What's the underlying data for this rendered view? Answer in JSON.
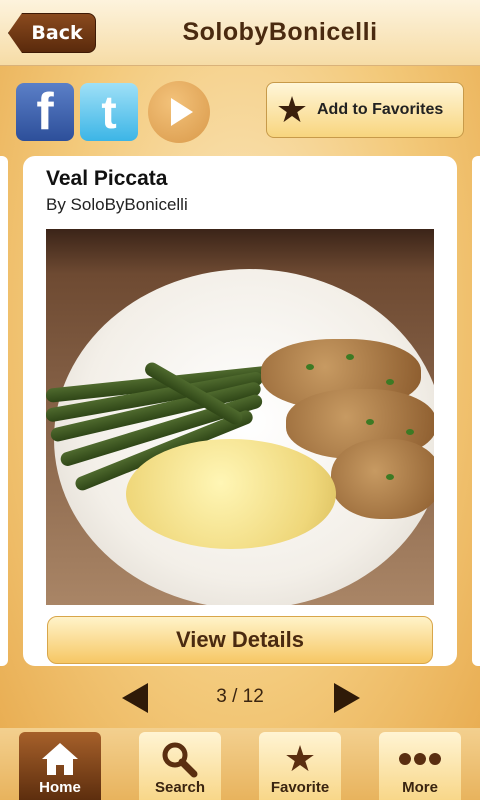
{
  "header": {
    "back_label": "Back",
    "title": "SolobyBonicelli"
  },
  "share": {
    "facebook_glyph": "f",
    "twitter_glyph": "t",
    "favorites_label": "Add to Favorites"
  },
  "recipe": {
    "title": "Veal Piccata",
    "author": "By SoloByBonicelli",
    "details_label": "View Details"
  },
  "pager": {
    "text": "3 / 12"
  },
  "tabs": [
    {
      "label": "Home",
      "icon": "home-icon",
      "active": true
    },
    {
      "label": "Search",
      "icon": "search-icon",
      "active": false
    },
    {
      "label": "Favorite",
      "icon": "star-icon",
      "active": false
    },
    {
      "label": "More",
      "icon": "more-icon",
      "active": false
    }
  ],
  "colors": {
    "accent_dark": "#5a2a0c",
    "title_brown": "#4a2a10",
    "button_gold": "#f6c764"
  }
}
